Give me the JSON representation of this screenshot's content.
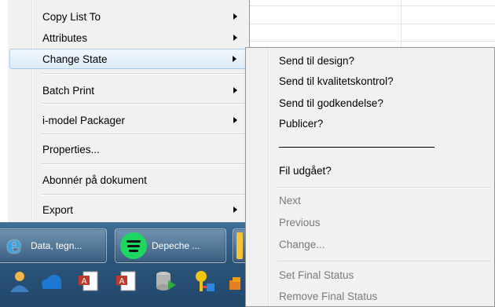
{
  "context_menu": {
    "items": [
      {
        "label": "Copy List To",
        "has_submenu": true
      },
      {
        "label": "Attributes",
        "has_submenu": true
      },
      {
        "label": "Change State",
        "has_submenu": true,
        "highlighted": true
      },
      {
        "label": "Batch Print",
        "has_submenu": true
      },
      {
        "label": "i-model Packager",
        "has_submenu": true
      },
      {
        "label": "Properties...",
        "has_submenu": false
      },
      {
        "label": "Abonnér på dokument",
        "has_submenu": false
      },
      {
        "label": "Export",
        "has_submenu": true
      }
    ]
  },
  "submenu": {
    "items": [
      {
        "label": "Send til design?",
        "enabled": true
      },
      {
        "label": "Send til kvalitetskontrol?",
        "enabled": true
      },
      {
        "label": "Send til godkendelse?",
        "enabled": true
      },
      {
        "label": "Publicer?",
        "enabled": true
      },
      {
        "label": "Fil udgået?",
        "enabled": true
      },
      {
        "label": "Next",
        "enabled": false
      },
      {
        "label": "Previous",
        "enabled": false
      },
      {
        "label": "Change...",
        "enabled": false
      },
      {
        "label": "Set Final Status",
        "enabled": false
      },
      {
        "label": "Remove Final Status",
        "enabled": false
      }
    ]
  },
  "taskbar": {
    "buttons": [
      {
        "label": "Data, tegn...",
        "icon": "internet-explorer-icon"
      },
      {
        "label": "Depeche ...",
        "icon": "spotify-icon"
      }
    ],
    "tray_icons": [
      "person-icon",
      "cloud-icon",
      "document-icon",
      "document-icon",
      "database-icon",
      "key-icon",
      "app-icon"
    ]
  },
  "colors": {
    "menu_background": "#f1f1f1",
    "highlight_background": "#dcebf9",
    "highlight_border": "#a8cbee",
    "disabled_text": "#7a7a7a",
    "taskbar": "#2d557a"
  }
}
